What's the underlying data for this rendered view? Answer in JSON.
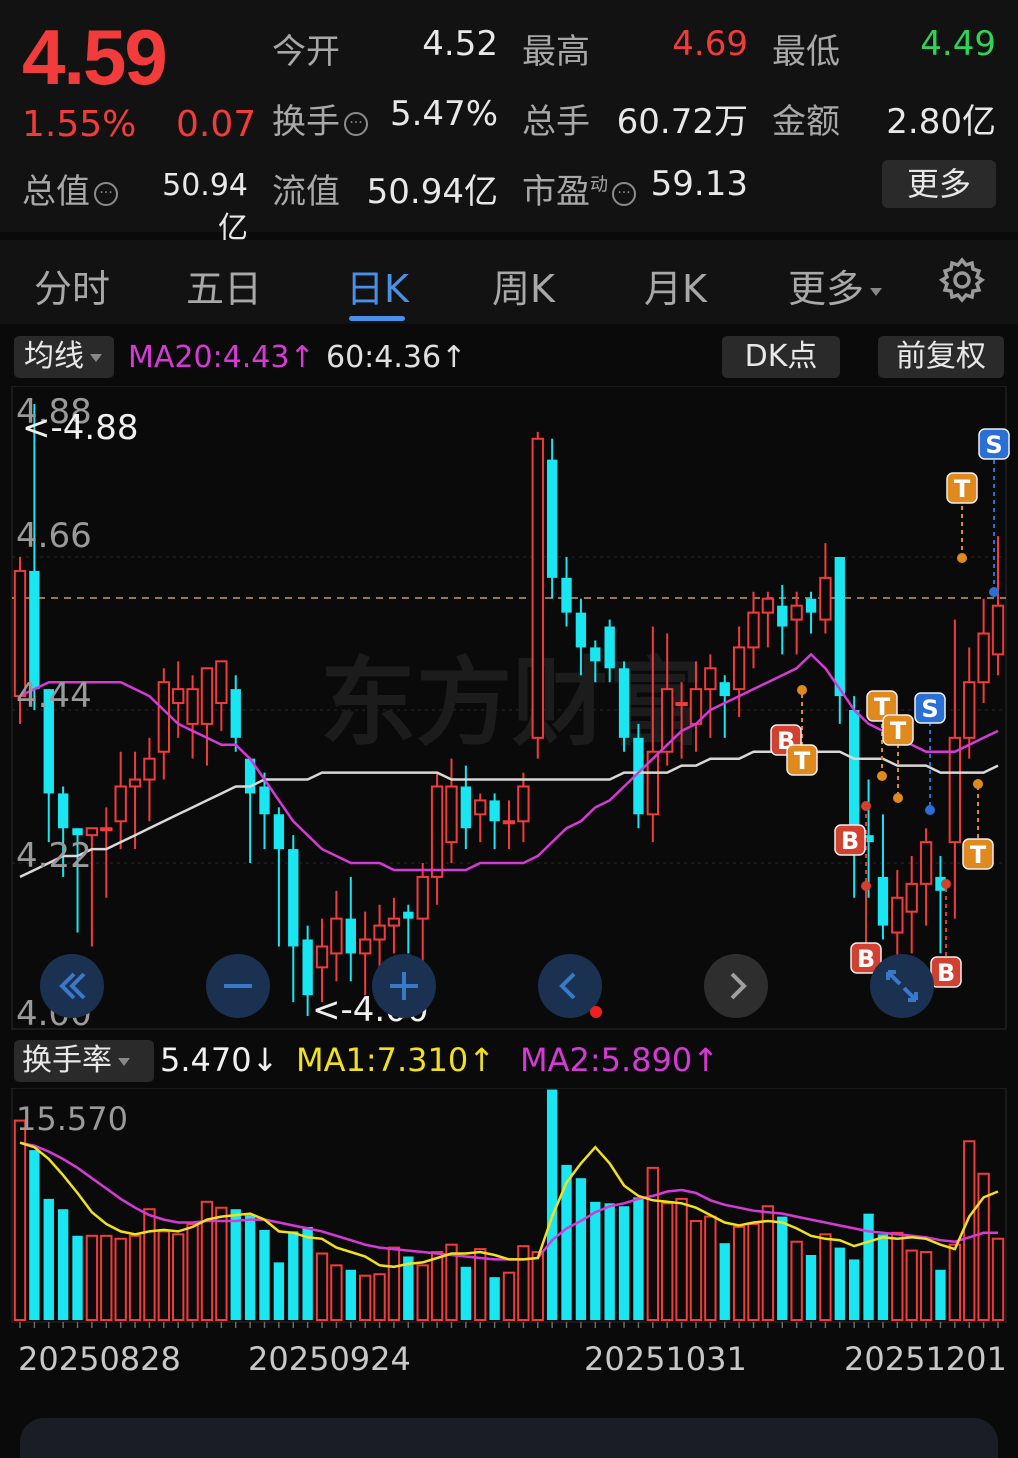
{
  "quote": {
    "price": "4.59",
    "change_pct": "1.55%",
    "change_amt": "0.07",
    "open_label": "今开",
    "open_value": "4.52",
    "high_label": "最高",
    "high_value": "4.69",
    "low_label": "最低",
    "low_value": "4.49",
    "turnover_label": "换手",
    "turnover_value": "5.47%",
    "volume_label": "总手",
    "volume_value": "60.72万",
    "amount_label": "金额",
    "amount_value": "2.80亿",
    "mktcap_label": "总值",
    "mktcap_value": "50.94亿",
    "float_label": "流值",
    "float_value": "50.94亿",
    "pe_label": "市盈",
    "pe_sup": "动",
    "pe_value": "59.13",
    "more_button": "更多",
    "colors": {
      "up": "#f23b3b",
      "down": "#2fd25a"
    }
  },
  "tabs": [
    {
      "label": "分时"
    },
    {
      "label": "五日"
    },
    {
      "label": "日K",
      "active": true
    },
    {
      "label": "周K"
    },
    {
      "label": "月K"
    },
    {
      "label": "更多"
    }
  ],
  "settings_icon": "gear-icon",
  "main_chart": {
    "indicator_select": "均线",
    "ma20_text": "MA20:4.43↑",
    "ma60_text": "60:4.36↑",
    "dk_button": "DK点",
    "adjust_button": "前复权",
    "axis_labels": [
      "4.88",
      "4.66",
      "4.44",
      "4.22",
      "4.00"
    ],
    "max_marker": "<-4.88",
    "min_marker": "<-4.00",
    "watermark": "东方财富",
    "colors": {
      "up": "#f23b3b",
      "down": "#19e6f0",
      "ma20": "#d63ad6",
      "ma60": "#d8d8d8",
      "ref_line": "#c8a060"
    }
  },
  "sub_chart": {
    "indicator_select": "换手率",
    "current_text": "5.470↓",
    "ma1_text": "MA1:7.310↑",
    "ma2_text": "MA2:5.890↑",
    "axis_label": "15.570",
    "colors": {
      "ma1": "#f0e020",
      "ma2": "#d63ad6"
    }
  },
  "dates": [
    "20250828",
    "20250924",
    "20251031",
    "20251201"
  ],
  "nav_buttons": [
    "double-left-icon",
    "zoom-out-icon",
    "zoom-in-icon",
    "left-icon",
    "right-icon",
    "fullscreen-icon"
  ],
  "chart_data": {
    "type": "candlestick",
    "y_range": [
      4.0,
      4.88
    ],
    "candles": [
      {
        "o": 4.46,
        "c": 4.64,
        "h": 4.66,
        "l": 4.42
      },
      {
        "o": 4.64,
        "c": 4.47,
        "h": 4.88,
        "l": 4.44
      },
      {
        "o": 4.47,
        "c": 4.32,
        "h": 4.47,
        "l": 4.25
      },
      {
        "o": 4.32,
        "c": 4.27,
        "h": 4.33,
        "l": 4.2
      },
      {
        "o": 4.27,
        "c": 4.26,
        "h": 4.27,
        "l": 4.12
      },
      {
        "o": 4.26,
        "c": 4.27,
        "h": 4.27,
        "l": 4.1
      },
      {
        "o": 4.27,
        "c": 4.27,
        "h": 4.3,
        "l": 4.17
      },
      {
        "o": 4.28,
        "c": 4.33,
        "h": 4.38,
        "l": 4.24
      },
      {
        "o": 4.33,
        "c": 4.34,
        "h": 4.38,
        "l": 4.24
      },
      {
        "o": 4.34,
        "c": 4.37,
        "h": 4.4,
        "l": 4.28
      },
      {
        "o": 4.38,
        "c": 4.48,
        "h": 4.5,
        "l": 4.34
      },
      {
        "o": 4.45,
        "c": 4.47,
        "h": 4.51,
        "l": 4.4
      },
      {
        "o": 4.42,
        "c": 4.47,
        "h": 4.49,
        "l": 4.37
      },
      {
        "o": 4.42,
        "c": 4.5,
        "h": 4.5,
        "l": 4.36
      },
      {
        "o": 4.45,
        "c": 4.51,
        "h": 4.51,
        "l": 4.41
      },
      {
        "o": 4.47,
        "c": 4.4,
        "h": 4.49,
        "l": 4.38
      },
      {
        "o": 4.37,
        "c": 4.32,
        "h": 4.37,
        "l": 4.22
      },
      {
        "o": 4.33,
        "c": 4.29,
        "h": 4.35,
        "l": 4.24
      },
      {
        "o": 4.29,
        "c": 4.24,
        "h": 4.3,
        "l": 4.1
      },
      {
        "o": 4.24,
        "c": 4.1,
        "h": 4.26,
        "l": 4.02
      },
      {
        "o": 4.11,
        "c": 4.03,
        "h": 4.13,
        "l": 4.0
      },
      {
        "o": 4.07,
        "c": 4.1,
        "h": 4.14,
        "l": 4.02
      },
      {
        "o": 4.09,
        "c": 4.14,
        "h": 4.18,
        "l": 4.05
      },
      {
        "o": 4.14,
        "c": 4.09,
        "h": 4.2,
        "l": 4.05
      },
      {
        "o": 4.09,
        "c": 4.11,
        "h": 4.15,
        "l": 4.03
      },
      {
        "o": 4.11,
        "c": 4.13,
        "h": 4.16,
        "l": 4.07
      },
      {
        "o": 4.13,
        "c": 4.14,
        "h": 4.17,
        "l": 4.09
      },
      {
        "o": 4.15,
        "c": 4.14,
        "h": 4.16,
        "l": 4.09
      },
      {
        "o": 4.14,
        "c": 4.2,
        "h": 4.22,
        "l": 4.07
      },
      {
        "o": 4.2,
        "c": 4.33,
        "h": 4.35,
        "l": 4.16
      },
      {
        "o": 4.25,
        "c": 4.33,
        "h": 4.37,
        "l": 4.22
      },
      {
        "o": 4.33,
        "c": 4.27,
        "h": 4.36,
        "l": 4.24
      },
      {
        "o": 4.29,
        "c": 4.31,
        "h": 4.32,
        "l": 4.25
      },
      {
        "o": 4.31,
        "c": 4.28,
        "h": 4.32,
        "l": 4.24
      },
      {
        "o": 4.28,
        "c": 4.28,
        "h": 4.31,
        "l": 4.24
      },
      {
        "o": 4.28,
        "c": 4.33,
        "h": 4.35,
        "l": 4.25
      },
      {
        "o": 4.4,
        "c": 4.83,
        "h": 4.84,
        "l": 4.37
      },
      {
        "o": 4.8,
        "c": 4.63,
        "h": 4.83,
        "l": 4.6
      },
      {
        "o": 4.63,
        "c": 4.58,
        "h": 4.66,
        "l": 4.56
      },
      {
        "o": 4.58,
        "c": 4.53,
        "h": 4.6,
        "l": 4.49
      },
      {
        "o": 4.53,
        "c": 4.51,
        "h": 4.54,
        "l": 4.48
      },
      {
        "o": 4.56,
        "c": 4.5,
        "h": 4.57,
        "l": 4.48
      },
      {
        "o": 4.5,
        "c": 4.4,
        "h": 4.51,
        "l": 4.38
      },
      {
        "o": 4.4,
        "c": 4.29,
        "h": 4.42,
        "l": 4.27
      },
      {
        "o": 4.29,
        "c": 4.38,
        "h": 4.56,
        "l": 4.25
      },
      {
        "o": 4.38,
        "c": 4.47,
        "h": 4.55,
        "l": 4.36
      },
      {
        "o": 4.45,
        "c": 4.45,
        "h": 4.48,
        "l": 4.37
      },
      {
        "o": 4.42,
        "c": 4.47,
        "h": 4.51,
        "l": 4.38
      },
      {
        "o": 4.47,
        "c": 4.5,
        "h": 4.52,
        "l": 4.4
      },
      {
        "o": 4.48,
        "c": 4.46,
        "h": 4.49,
        "l": 4.4
      },
      {
        "o": 4.47,
        "c": 4.53,
        "h": 4.56,
        "l": 4.43
      },
      {
        "o": 4.53,
        "c": 4.58,
        "h": 4.61,
        "l": 4.5
      },
      {
        "o": 4.58,
        "c": 4.6,
        "h": 4.61,
        "l": 4.53
      },
      {
        "o": 4.59,
        "c": 4.56,
        "h": 4.62,
        "l": 4.52
      },
      {
        "o": 4.57,
        "c": 4.59,
        "h": 4.61,
        "l": 4.52
      },
      {
        "o": 4.6,
        "c": 4.58,
        "h": 4.61,
        "l": 4.55
      },
      {
        "o": 4.57,
        "c": 4.63,
        "h": 4.68,
        "l": 4.55
      },
      {
        "o": 4.66,
        "c": 4.46,
        "h": 4.66,
        "l": 4.42
      },
      {
        "o": 4.44,
        "c": 4.24,
        "h": 4.46,
        "l": 4.17
      },
      {
        "o": 4.26,
        "c": 4.25,
        "h": 4.34,
        "l": 4.17
      },
      {
        "o": 4.2,
        "c": 4.13,
        "h": 4.29,
        "l": 4.11
      },
      {
        "o": 4.12,
        "c": 4.17,
        "h": 4.21,
        "l": 4.08
      },
      {
        "o": 4.15,
        "c": 4.19,
        "h": 4.23,
        "l": 4.09
      },
      {
        "o": 4.19,
        "c": 4.25,
        "h": 4.27,
        "l": 4.13
      },
      {
        "o": 4.2,
        "c": 4.18,
        "h": 4.23,
        "l": 4.09
      },
      {
        "o": 4.25,
        "c": 4.4,
        "h": 4.57,
        "l": 4.14
      },
      {
        "o": 4.4,
        "c": 4.48,
        "h": 4.53,
        "l": 4.37
      },
      {
        "o": 4.48,
        "c": 4.55,
        "h": 4.6,
        "l": 4.45
      },
      {
        "o": 4.52,
        "c": 4.59,
        "h": 4.69,
        "l": 4.49
      }
    ],
    "ma20": [
      4.46,
      4.47,
      4.48,
      4.48,
      4.48,
      4.48,
      4.48,
      4.48,
      4.47,
      4.46,
      4.44,
      4.42,
      4.41,
      4.4,
      4.39,
      4.39,
      4.37,
      4.34,
      4.31,
      4.28,
      4.26,
      4.24,
      4.23,
      4.22,
      4.22,
      4.22,
      4.21,
      4.21,
      4.21,
      4.21,
      4.21,
      4.21,
      4.22,
      4.22,
      4.22,
      4.22,
      4.23,
      4.25,
      4.27,
      4.28,
      4.3,
      4.31,
      4.33,
      4.35,
      4.37,
      4.39,
      4.41,
      4.42,
      4.44,
      4.45,
      4.46,
      4.47,
      4.48,
      4.49,
      4.5,
      4.52,
      4.5,
      4.47,
      4.44,
      4.42,
      4.41,
      4.4,
      4.39,
      4.38,
      4.38,
      4.38,
      4.39,
      4.4,
      4.41
    ],
    "ma60": [
      4.2,
      4.21,
      4.22,
      4.23,
      4.23,
      4.24,
      4.24,
      4.25,
      4.26,
      4.27,
      4.28,
      4.29,
      4.3,
      4.31,
      4.32,
      4.33,
      4.33,
      4.34,
      4.34,
      4.34,
      4.34,
      4.35,
      4.35,
      4.35,
      4.35,
      4.35,
      4.35,
      4.35,
      4.35,
      4.35,
      4.34,
      4.34,
      4.34,
      4.34,
      4.34,
      4.34,
      4.34,
      4.34,
      4.34,
      4.34,
      4.34,
      4.34,
      4.35,
      4.35,
      4.35,
      4.35,
      4.36,
      4.36,
      4.37,
      4.37,
      4.37,
      4.38,
      4.38,
      4.38,
      4.38,
      4.38,
      4.38,
      4.38,
      4.37,
      4.37,
      4.37,
      4.36,
      4.36,
      4.36,
      4.35,
      4.35,
      4.35,
      4.35,
      4.36
    ],
    "turnover": [
      13.5,
      11.5,
      8.2,
      7.5,
      5.7,
      5.7,
      5.7,
      5.5,
      5.7,
      7.5,
      6.0,
      5.8,
      6.5,
      8.0,
      7.6,
      7.5,
      7.1,
      6.1,
      3.9,
      6.0,
      6.3,
      4.5,
      3.7,
      3.4,
      3.0,
      3.1,
      4.9,
      4.3,
      3.7,
      4.6,
      5.1,
      3.6,
      4.8,
      2.9,
      3.2,
      5.0,
      4.6,
      15.6,
      10.5,
      9.6,
      8.0,
      7.9,
      7.7,
      8.3,
      10.3,
      7.9,
      8.2,
      6.7,
      7.0,
      5.2,
      6.3,
      6.5,
      7.7,
      7.0,
      5.3,
      4.4,
      5.8,
      4.9,
      4.1,
      7.2,
      5.8,
      5.9,
      4.7,
      4.6,
      3.4,
      5.1,
      12.1,
      9.9,
      5.5
    ],
    "turnover_ma1": [
      12.0,
      11.7,
      10.9,
      9.8,
      8.6,
      7.3,
      6.5,
      6.0,
      5.8,
      6.0,
      6.1,
      6.0,
      6.3,
      6.8,
      7.0,
      7.1,
      7.2,
      6.8,
      6.0,
      5.9,
      5.6,
      5.5,
      4.9,
      4.6,
      4.3,
      3.7,
      3.6,
      3.8,
      3.9,
      4.2,
      4.5,
      4.5,
      4.6,
      4.4,
      4.1,
      4.1,
      4.2,
      7.0,
      9.3,
      10.6,
      11.7,
      10.6,
      9.1,
      8.4,
      8.1,
      8.0,
      7.9,
      7.6,
      7.1,
      6.6,
      6.4,
      6.6,
      6.7,
      6.6,
      6.2,
      5.7,
      5.5,
      5.4,
      5.0,
      5.3,
      5.6,
      5.5,
      5.6,
      5.5,
      5.1,
      4.8,
      7.0,
      8.3,
      8.7
    ],
    "turnover_ma2": [
      12.0,
      11.8,
      11.4,
      10.9,
      10.3,
      9.6,
      8.9,
      8.2,
      7.6,
      7.1,
      6.8,
      6.6,
      6.6,
      6.7,
      6.7,
      6.7,
      6.8,
      6.8,
      6.6,
      6.4,
      6.2,
      6.0,
      5.7,
      5.4,
      5.1,
      4.9,
      4.8,
      4.7,
      4.6,
      4.5,
      4.4,
      4.3,
      4.2,
      4.1,
      4.1,
      4.1,
      4.2,
      5.4,
      6.2,
      6.7,
      7.3,
      7.7,
      7.9,
      8.2,
      8.4,
      8.7,
      8.8,
      8.6,
      8.1,
      7.8,
      7.6,
      7.4,
      7.3,
      7.2,
      7.0,
      6.8,
      6.6,
      6.4,
      6.2,
      6.0,
      5.9,
      5.8,
      5.7,
      5.6,
      5.4,
      5.3,
      5.6,
      5.9,
      5.9
    ],
    "turnover_ylim": [
      0,
      15.57
    ]
  }
}
